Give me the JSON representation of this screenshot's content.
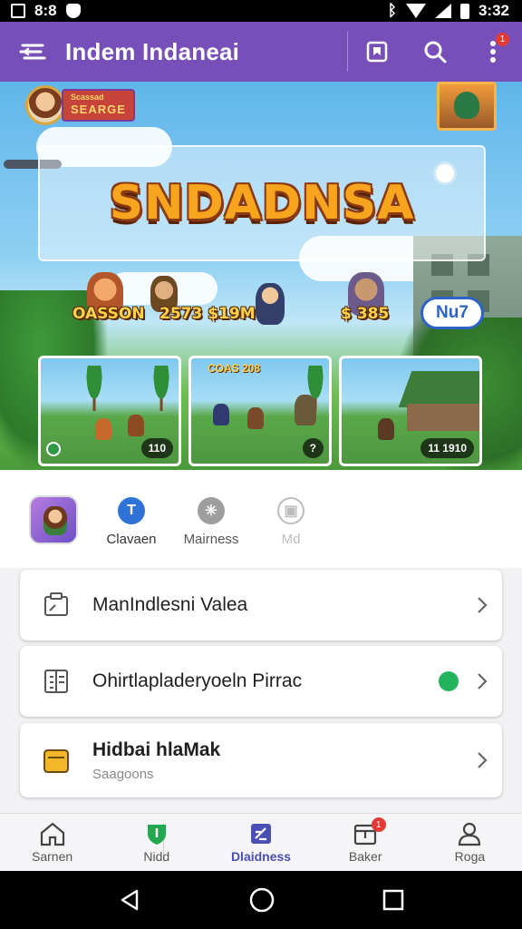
{
  "status_bar": {
    "time_left": "8:8",
    "time_right": "3:32"
  },
  "app_bar": {
    "title": "Indem Indaneai",
    "notification_count": "1"
  },
  "banner": {
    "profile": {
      "rank_label": "Scassad",
      "name": "SEARGE"
    },
    "logo": "SNDADNSA",
    "stats": {
      "left": "OASSON",
      "middle": "2573 $19M",
      "right": "$ 385"
    },
    "pill_label": "Nu7",
    "screenshots": [
      {
        "badge": "110",
        "label": ""
      },
      {
        "badge": "?",
        "label": "COAS 208"
      },
      {
        "badge": "11 1910",
        "label": ""
      }
    ]
  },
  "quick_actions": [
    {
      "label": "Clavaen",
      "icon": "info-icon",
      "color": "#2f73d9"
    },
    {
      "label": "Mairness",
      "icon": "star-icon",
      "color": "#9e9e9e"
    },
    {
      "label": "Md",
      "icon": "lock-icon",
      "color": "#bdbdbd"
    }
  ],
  "cards": [
    {
      "title": "ManIndlesni Valea",
      "subtitle": "",
      "icon": "clipboard-icon",
      "status": ""
    },
    {
      "title": "Ohirtlapladeryoeln Pirrac",
      "subtitle": "",
      "icon": "document-icon",
      "status": "online"
    },
    {
      "title": "Hidbai hlaMak",
      "subtitle": "Saagoons",
      "icon": "folder-icon",
      "status": ""
    }
  ],
  "bottom_nav": [
    {
      "label": "Sarnen",
      "icon": "home-icon"
    },
    {
      "label": "Nidd",
      "icon": "shield-icon"
    },
    {
      "label": "Dlaidness",
      "icon": "edit-icon",
      "active": true
    },
    {
      "label": "Baker",
      "icon": "tray-icon",
      "badge": "1"
    },
    {
      "label": "Roga",
      "icon": "person-icon"
    }
  ],
  "colors": {
    "primary": "#7650b8",
    "accent_blue": "#2d63c8",
    "status_green": "#23b35d",
    "badge_red": "#e53935"
  }
}
